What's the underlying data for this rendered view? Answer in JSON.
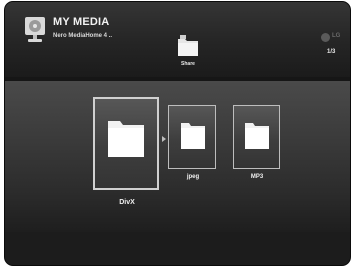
{
  "header": {
    "title": "MY MEDIA",
    "server_name": "Nero MediaHome 4 ..",
    "share_label": "Share",
    "brand": "LG",
    "page_counter": "1/3"
  },
  "folders": [
    {
      "label": "DivX",
      "selected": true
    },
    {
      "label": "jpeg",
      "selected": false
    },
    {
      "label": "MP3",
      "selected": false
    }
  ],
  "icons": {
    "media": "media-server-icon",
    "share": "share-folder-icon",
    "logo": "lg-logo-icon",
    "folder": "folder-icon"
  }
}
